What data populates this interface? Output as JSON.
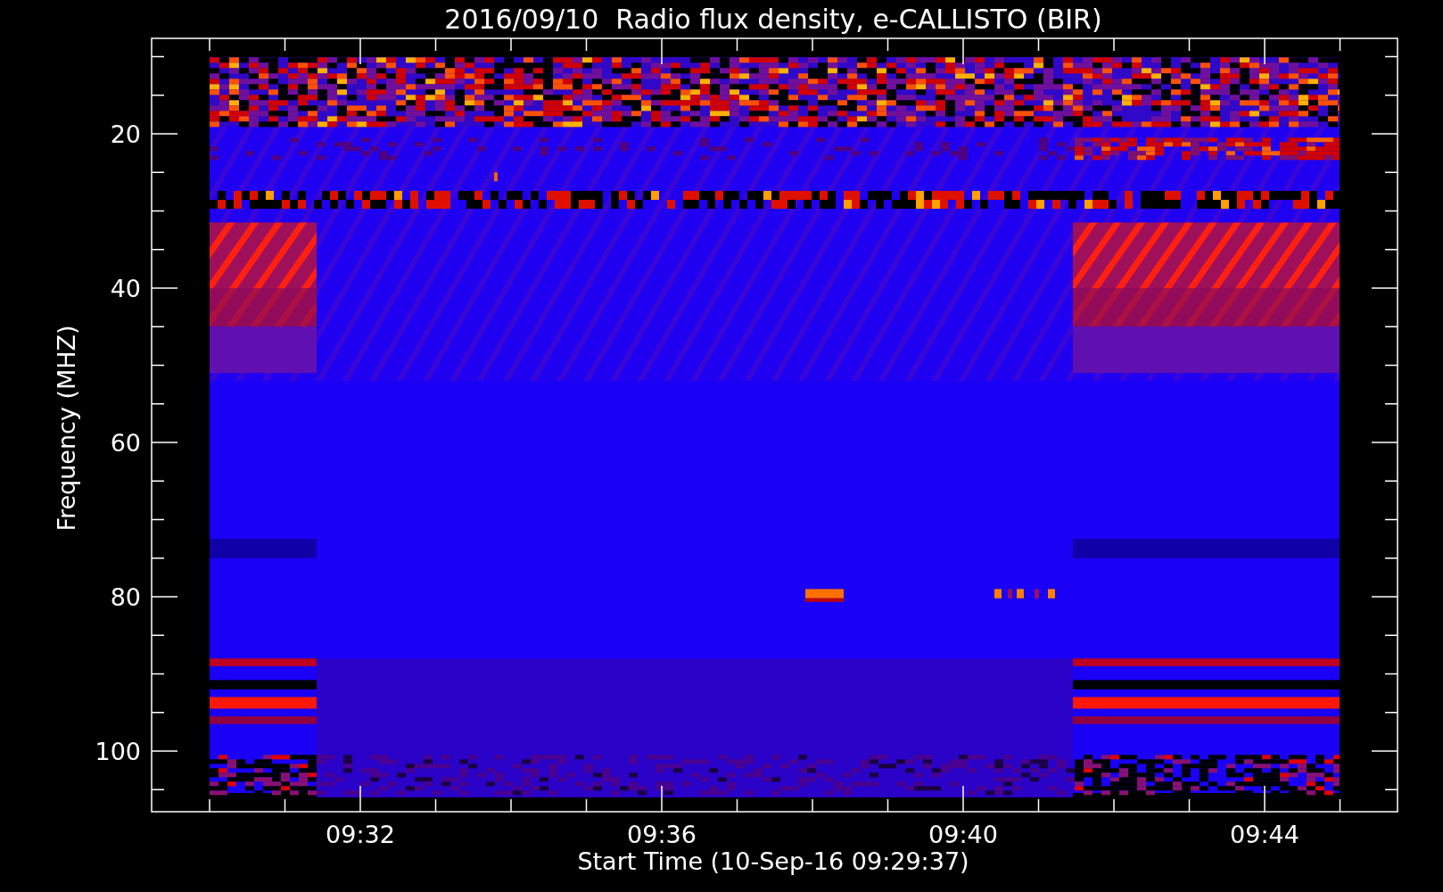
{
  "title": "2016/09/10  Radio flux density, e-CALLISTO (BIR)",
  "y_axis": {
    "label": "Frequency (MHZ)",
    "ticks": [
      "20",
      "40",
      "60",
      "80",
      "100"
    ]
  },
  "x_axis": {
    "label": "Start Time (10-Sep-16 09:29:37)",
    "ticks": [
      "09:32",
      "09:36",
      "09:40",
      "09:44"
    ]
  }
}
